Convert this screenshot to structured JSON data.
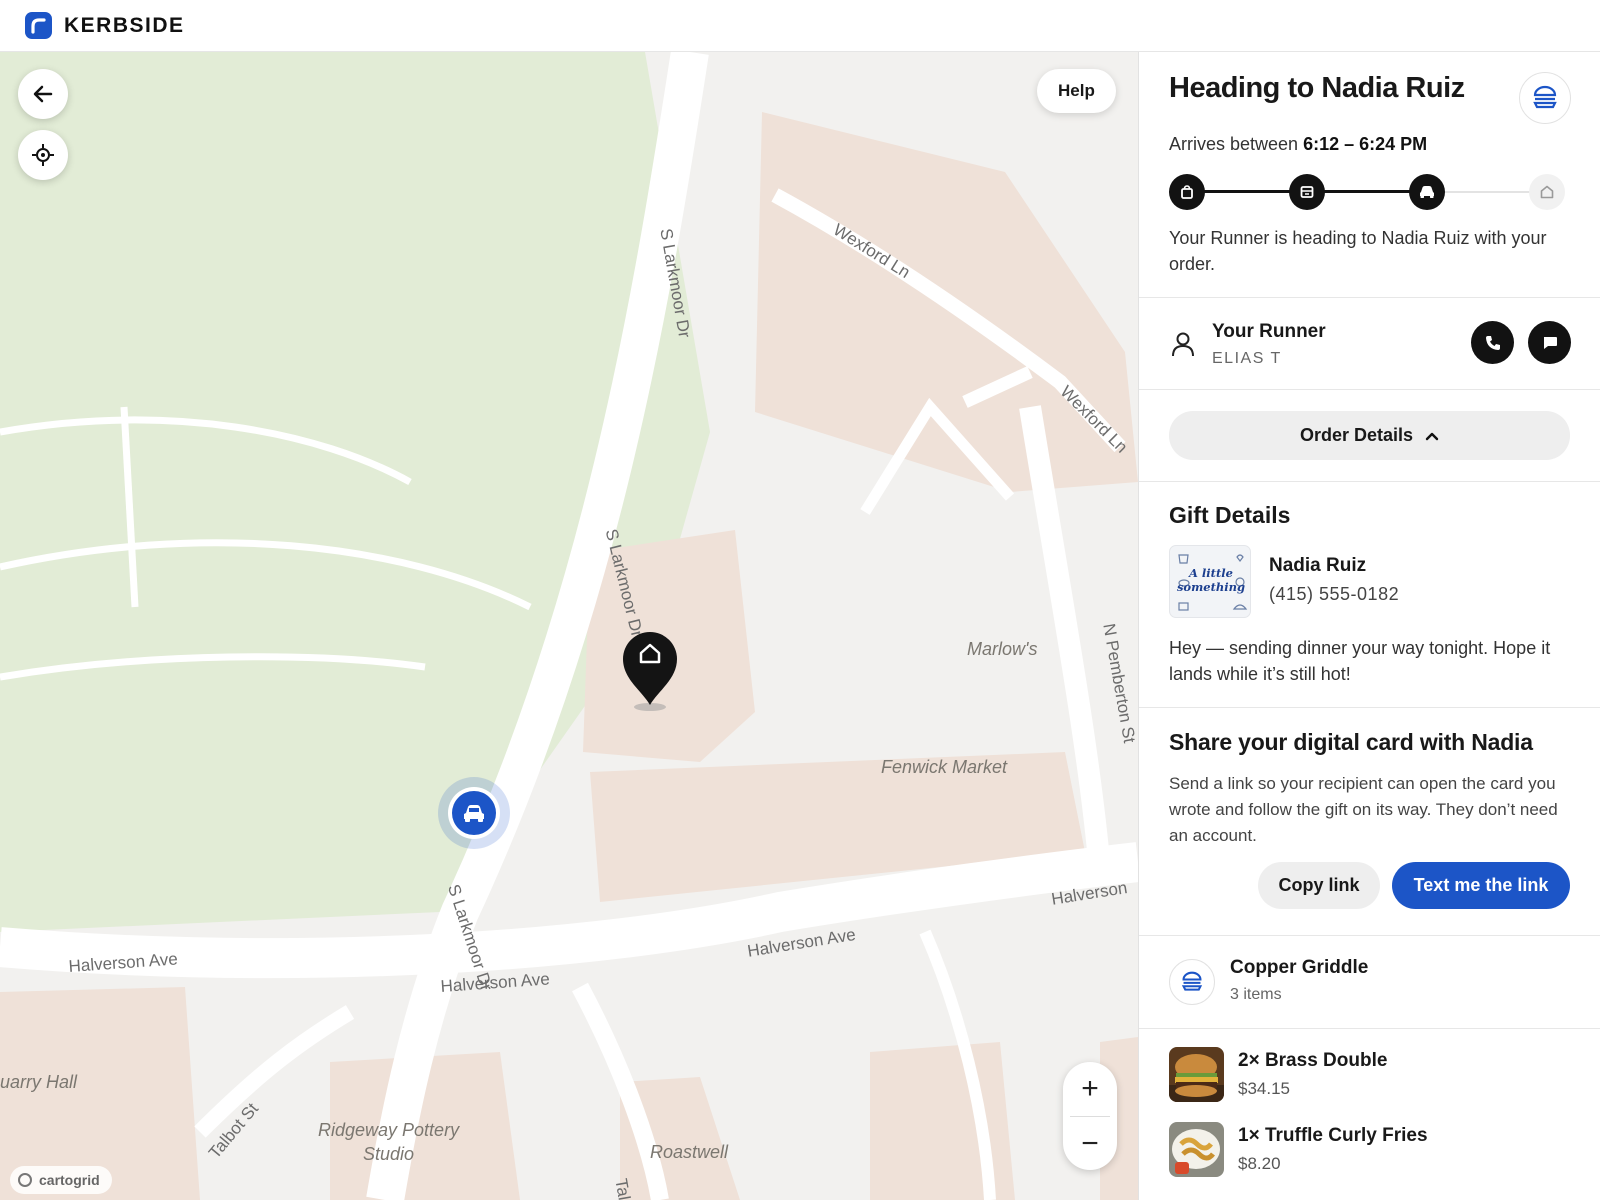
{
  "app": {
    "brand": "KERBSIDE"
  },
  "map": {
    "help_label": "Help",
    "attribution": "cartogrid",
    "zoom_in": "+",
    "zoom_out": "−",
    "streets": {
      "larkmoor_top": "S Larkmoor Dr",
      "larkmoor_mid": "S Larkmoor Dr",
      "larkmoor_low": "S Larkmoor Dr",
      "wexford_1": "Wexford Ln",
      "wexford_2": "Wexford Ln",
      "pemberton": "N Pemberton St",
      "halverson_left": "Halverson Ave",
      "halverson_mid": "Halverson Ave",
      "halverson_center": "Halverson Ave",
      "halverson_right": "Halverson",
      "talbot": "Talbot St",
      "tal": "Tal"
    },
    "places": {
      "marlows": "Marlow's",
      "fenwick": "Fenwick Market",
      "quarry": "uarry Hall",
      "ridgeway_1": "Ridgeway Pottery",
      "ridgeway_2": "Studio",
      "roastwell": "Roastwell"
    }
  },
  "status": {
    "title": "Heading to Nadia Ruiz",
    "arrives_prefix": "Arrives between",
    "arrives_window": "6:12 – 6:24 PM",
    "description": "Your Runner is heading to Nadia Ruiz with your order.",
    "steps": [
      "bag-icon",
      "store-icon",
      "car-icon",
      "home-icon"
    ],
    "progress_completed_steps": 3
  },
  "runner": {
    "heading": "Your Runner",
    "name": "ELIAS T"
  },
  "order_details_label": "Order Details",
  "gift": {
    "heading": "Gift Details",
    "card_line1": "A little",
    "card_line2": "something",
    "recipient": "Nadia Ruiz",
    "phone": "(415) 555-0182",
    "message": "Hey — sending dinner your way tonight. Hope it lands while it’s still hot!"
  },
  "share": {
    "heading": "Share your digital card with Nadia",
    "body": "Send a link so your recipient can open the card you wrote and follow the gift on its way. They don’t need an account.",
    "copy_label": "Copy link",
    "text_label": "Text me the link"
  },
  "restaurant": {
    "name": "Copper Griddle",
    "item_count": "3 items"
  },
  "items": [
    {
      "title": "2× Brass Double",
      "price": "$34.15"
    },
    {
      "title": "1× Truffle Curly Fries",
      "price": "$8.20"
    }
  ],
  "colors": {
    "accent": "#1c55c7",
    "park": "#e2ecd6",
    "block": "#efe1d8",
    "road": "#ffffff",
    "land": "#f2f1ef"
  }
}
